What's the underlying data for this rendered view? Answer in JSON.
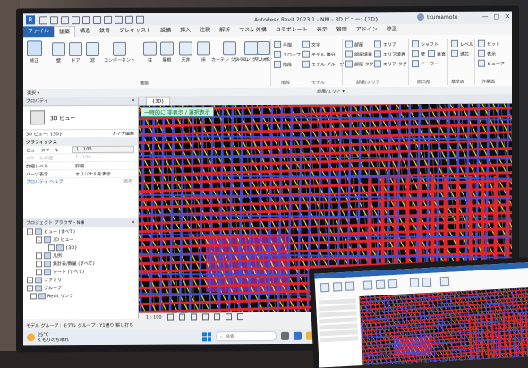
{
  "app": {
    "title": "Autodesk Revit 2023.1 - N棟 - 3D ビュー: {3D}",
    "user": "tkumamoto",
    "window_controls": [
      "—",
      "□",
      "✕"
    ]
  },
  "ribbon_tabs": [
    "ファイル",
    "建築",
    "構造",
    "鉄骨",
    "プレキャスト",
    "設備",
    "挿入",
    "注釈",
    "解析",
    "マス& 外構",
    "コラボレート",
    "表示",
    "管理",
    "アドイン",
    "修正"
  ],
  "ribbon": {
    "modify": "修正",
    "buttons": [
      "壁",
      "ドア",
      "窓",
      "コンポーネント",
      "柱",
      "屋根",
      "天井",
      "床",
      "カーテン システム",
      "カーテン グリッド",
      "マリオン"
    ],
    "small": [
      "手摺",
      "スロープ",
      "階段",
      "文字",
      "モデル 線分",
      "モデル グループ",
      "部屋",
      "部屋境界",
      "部屋 タグ",
      "エリア",
      "エリア境界",
      "エリア タグ",
      "シャフト",
      "壁",
      "垂直",
      "ドーマー",
      "レベル",
      "通芯",
      "セット",
      "表示",
      "ビューア"
    ],
    "groups": [
      "構築",
      "階段",
      "モデル",
      "部屋/エリア",
      "開口部",
      "基準面",
      "作業面"
    ],
    "select_label": "選択 ▾",
    "room_area_label": "部屋/エリア ▾"
  },
  "properties": {
    "header": "プロパティ",
    "type_name": "3D ビュー",
    "view_selector": "3D ビュー: {3D}",
    "edit_type": "タイプ編集",
    "graphics_group": "グラフィックス",
    "rows": [
      {
        "k": "ビュー スケール",
        "v": "1 : 100",
        "muted": false,
        "box": true
      },
      {
        "k": "スケールの値",
        "v": "1 : 100",
        "muted": true,
        "box": false
      },
      {
        "k": "詳細レベル",
        "v": "詳細",
        "muted": false,
        "box": false
      },
      {
        "k": "パーツ表示",
        "v": "オリジナルを表示",
        "muted": false,
        "box": false
      }
    ],
    "help": "プロパティ ヘルプ",
    "apply": "適用"
  },
  "browser": {
    "header": "プロジェクト ブラウザ - N棟",
    "items": [
      {
        "label": "ビュー (すべて)",
        "box": "−",
        "indent": 4
      },
      {
        "label": "3D ビュー",
        "box": "−",
        "indent": 14
      },
      {
        "label": "{3D}",
        "box": "",
        "indent": 28
      },
      {
        "label": "凡例",
        "box": "",
        "indent": 14
      },
      {
        "label": "集計表/数量 (すべて)",
        "box": "",
        "indent": 14
      },
      {
        "label": "シート (すべて)",
        "box": "",
        "indent": 14
      },
      {
        "label": "ファミリ",
        "box": "+",
        "indent": 4
      },
      {
        "label": "グループ",
        "box": "+",
        "indent": 4
      },
      {
        "label": "Revit リンク",
        "box": "",
        "indent": 8
      }
    ]
  },
  "view": {
    "tab_label": "{3D}",
    "temp_label": "一時的に 非表示 / 選択表示",
    "scale": "1 : 100"
  },
  "status_bar": "モデル グループ : モデル グループ : Y1通り 帳し打ち",
  "taskbar": {
    "temp": "25°C",
    "weather": "くもりのち晴れ",
    "search": "検索"
  },
  "colors": {
    "rebar_red": "#e0262d",
    "rebar_blue": "#3b4fd8",
    "rebar_yellow": "#e9e23a",
    "rebar_magenta": "#e23ee0",
    "rebar_grey": "#8a8a8a",
    "accent": "#2a65b4"
  }
}
